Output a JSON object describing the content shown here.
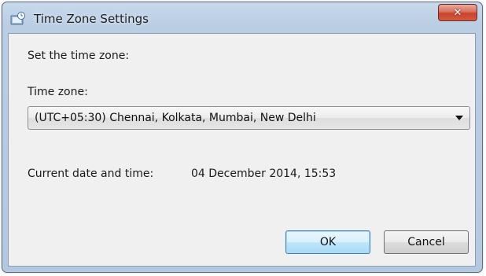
{
  "window": {
    "title": "Time Zone Settings",
    "icon": "clock-settings-icon",
    "close_glyph": "✕"
  },
  "dialog": {
    "prompt": "Set the time zone:",
    "timezone_label": "Time zone:",
    "timezone_value": "(UTC+05:30) Chennai, Kolkata, Mumbai, New Delhi",
    "current_label": "Current date and time:",
    "current_value": "04 December 2014, 15:53"
  },
  "buttons": {
    "ok": "OK",
    "cancel": "Cancel"
  },
  "colors": {
    "frame": "#b9cde3",
    "close": "#c9432c",
    "default_button_border": "#3c7fb1"
  }
}
